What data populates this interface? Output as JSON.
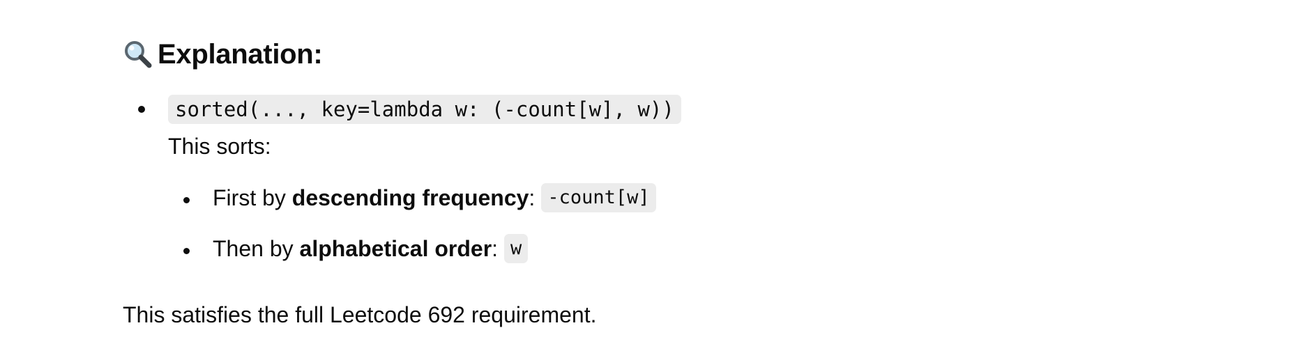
{
  "heading": {
    "icon": "magnifying-glass-icon",
    "text": "Explanation:"
  },
  "main_item": {
    "code": "sorted(..., key=lambda w: (-count[w], w))",
    "description": "This sorts:"
  },
  "sub_items": [
    {
      "prefix": "First by ",
      "bold": "descending frequency",
      "colon": ":",
      "code": "-count[w]"
    },
    {
      "prefix": "Then by ",
      "bold": "alphabetical order",
      "colon": ":",
      "code": "w"
    }
  ],
  "footer": "This satisfies the full Leetcode 692 requirement.",
  "colors": {
    "text": "#0d0d0d",
    "code_background": "#ececec"
  }
}
